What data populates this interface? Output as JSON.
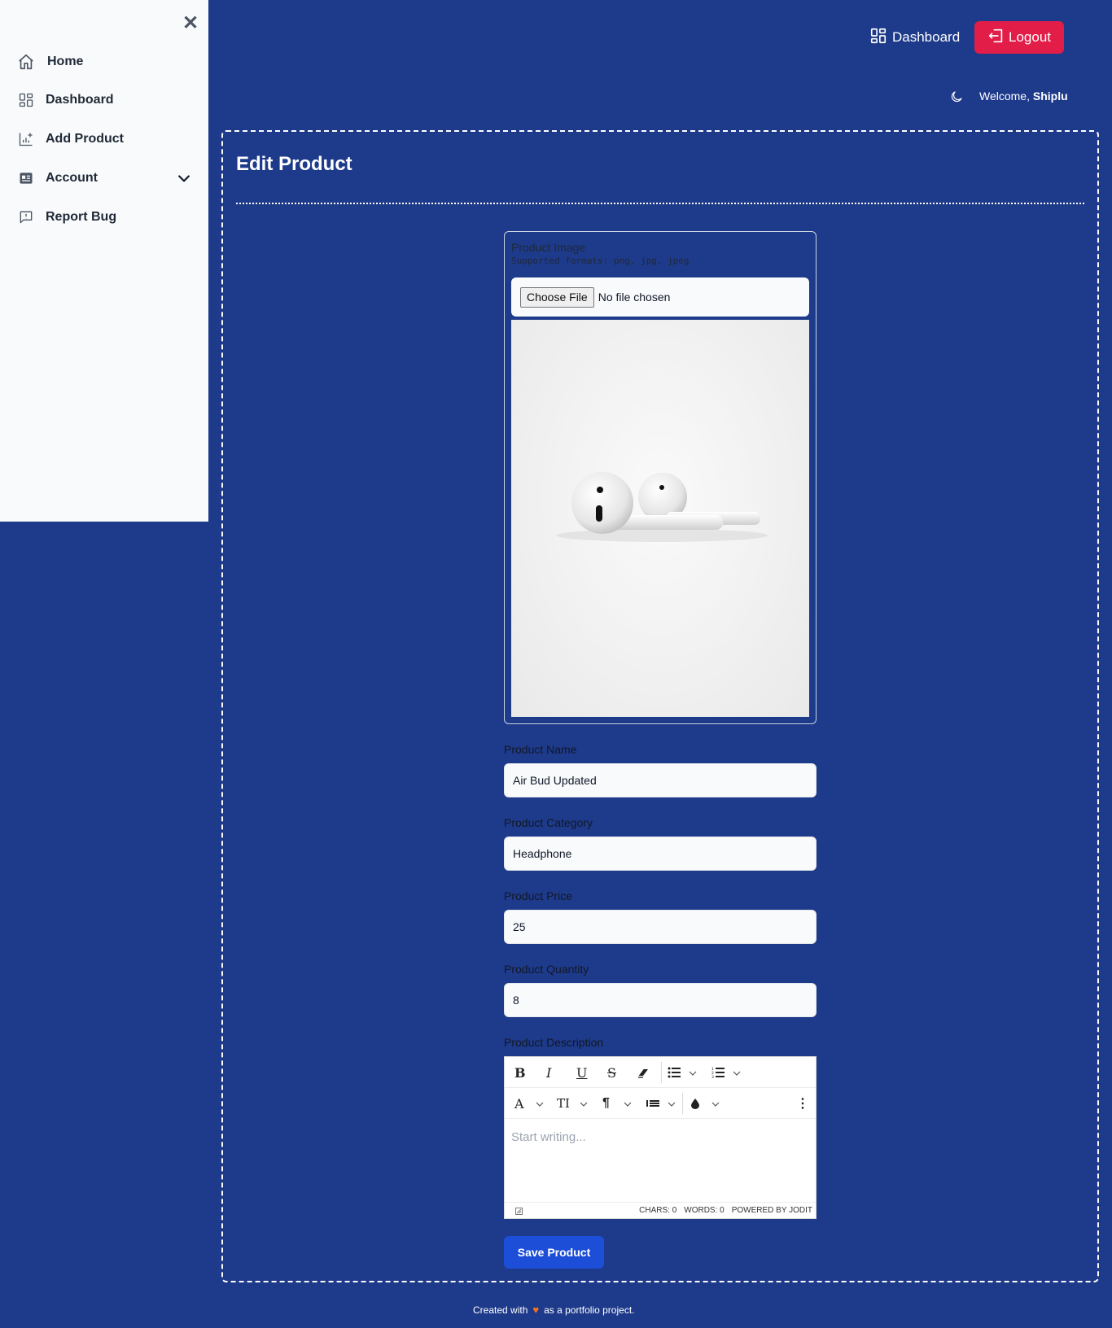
{
  "sidebar": {
    "close_icon": "close-icon",
    "items": [
      {
        "label": "Home",
        "icon": "home-icon"
      },
      {
        "label": "Dashboard",
        "icon": "grid-icon"
      },
      {
        "label": "Add Product",
        "icon": "chart-plus-icon"
      },
      {
        "label": "Account",
        "icon": "id-card-icon",
        "expandable": true
      },
      {
        "label": "Report Bug",
        "icon": "message-alert-icon"
      }
    ]
  },
  "header": {
    "dashboard_label": "Dashboard",
    "logout_label": "Logout",
    "welcome_prefix": "Welcome,",
    "user_name": "Shiplu"
  },
  "page": {
    "title": "Edit Product"
  },
  "form": {
    "image": {
      "label": "Product Image",
      "formats": "Supported formats: png, jpg, jpeg",
      "choose_file_label": "Choose File",
      "file_status": "No file chosen"
    },
    "name": {
      "label": "Product Name",
      "value": "Air Bud Updated"
    },
    "category": {
      "label": "Product Category",
      "value": "Headphone"
    },
    "price": {
      "label": "Product Price",
      "value": "25"
    },
    "quantity": {
      "label": "Product Quantity",
      "value": "8"
    },
    "description": {
      "label": "Product Description",
      "placeholder": "Start writing...",
      "chars": "CHARS: 0",
      "words": "WORDS: 0",
      "powered": "POWERED BY JODIT"
    },
    "save_label": "Save Product"
  },
  "footer": {
    "prefix": "Created with",
    "suffix": "as a portfolio project."
  },
  "colors": {
    "background": "#1e3a8a",
    "logout": "#e11d48",
    "save": "#1d4ed8",
    "heart": "#f97316"
  }
}
